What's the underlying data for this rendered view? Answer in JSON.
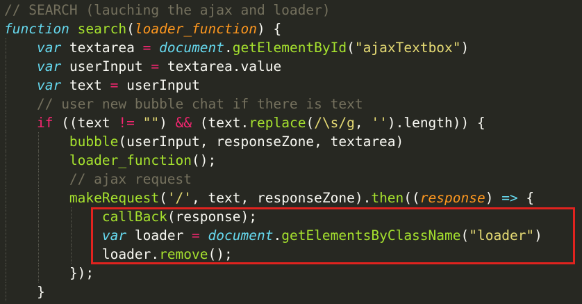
{
  "colors": {
    "background": "#272822",
    "comment": "#75715e",
    "keyword": "#66d9ef",
    "function": "#a6e22e",
    "parameter": "#fd971f",
    "operator": "#f92672",
    "string": "#e6db74",
    "plain": "#f8f8f2",
    "highlight_box": "#e0231f"
  },
  "code_lines": [
    {
      "indent": 0,
      "tokens": [
        {
          "t": "// SEARCH (lauching the ajax and loader)",
          "c": "comment"
        }
      ]
    },
    {
      "indent": 0,
      "tokens": [
        {
          "t": "function",
          "c": "kw"
        },
        {
          "t": " ",
          "c": "plain"
        },
        {
          "t": "search",
          "c": "fn"
        },
        {
          "t": "(",
          "c": "plain"
        },
        {
          "t": "loader_function",
          "c": "param"
        },
        {
          "t": ") {",
          "c": "plain"
        }
      ]
    },
    {
      "indent": 1,
      "tokens": [
        {
          "t": "var",
          "c": "kw"
        },
        {
          "t": " textarea ",
          "c": "plain"
        },
        {
          "t": "=",
          "c": "op"
        },
        {
          "t": " ",
          "c": "plain"
        },
        {
          "t": "document",
          "c": "builtin"
        },
        {
          "t": ".",
          "c": "plain"
        },
        {
          "t": "getElementById",
          "c": "fn"
        },
        {
          "t": "(",
          "c": "plain"
        },
        {
          "t": "\"ajaxTextbox\"",
          "c": "str"
        },
        {
          "t": ")",
          "c": "plain"
        }
      ]
    },
    {
      "indent": 1,
      "tokens": [
        {
          "t": "var",
          "c": "kw"
        },
        {
          "t": " userInput ",
          "c": "plain"
        },
        {
          "t": "=",
          "c": "op"
        },
        {
          "t": " textarea.value",
          "c": "plain"
        }
      ]
    },
    {
      "indent": 1,
      "tokens": [
        {
          "t": "var",
          "c": "kw"
        },
        {
          "t": " text ",
          "c": "plain"
        },
        {
          "t": "=",
          "c": "op"
        },
        {
          "t": " userInput",
          "c": "plain"
        }
      ]
    },
    {
      "indent": 1,
      "tokens": [
        {
          "t": "// user new bubble chat if there is text",
          "c": "comment"
        }
      ]
    },
    {
      "indent": 1,
      "tokens": [
        {
          "t": "if",
          "c": "op"
        },
        {
          "t": " ((text ",
          "c": "plain"
        },
        {
          "t": "!=",
          "c": "op"
        },
        {
          "t": " ",
          "c": "plain"
        },
        {
          "t": "\"\"",
          "c": "str"
        },
        {
          "t": ") ",
          "c": "plain"
        },
        {
          "t": "&&",
          "c": "op"
        },
        {
          "t": " (text.",
          "c": "plain"
        },
        {
          "t": "replace",
          "c": "fn"
        },
        {
          "t": "(",
          "c": "plain"
        },
        {
          "t": "/\\s/g",
          "c": "str"
        },
        {
          "t": ", ",
          "c": "plain"
        },
        {
          "t": "''",
          "c": "str"
        },
        {
          "t": ").length)) {",
          "c": "plain"
        }
      ]
    },
    {
      "indent": 2,
      "tokens": [
        {
          "t": "bubble",
          "c": "fn"
        },
        {
          "t": "(userInput, responseZone, textarea)",
          "c": "plain"
        }
      ]
    },
    {
      "indent": 2,
      "tokens": [
        {
          "t": "loader_function",
          "c": "fn"
        },
        {
          "t": "();",
          "c": "plain"
        }
      ]
    },
    {
      "indent": 2,
      "tokens": [
        {
          "t": "// ajax request",
          "c": "comment"
        }
      ]
    },
    {
      "indent": 2,
      "tokens": [
        {
          "t": "makeRequest",
          "c": "fn"
        },
        {
          "t": "(",
          "c": "plain"
        },
        {
          "t": "'/'",
          "c": "str"
        },
        {
          "t": ", text, responseZone).",
          "c": "plain"
        },
        {
          "t": "then",
          "c": "fn"
        },
        {
          "t": "((",
          "c": "plain"
        },
        {
          "t": "response",
          "c": "param"
        },
        {
          "t": ") ",
          "c": "plain"
        },
        {
          "t": "=>",
          "c": "kw"
        },
        {
          "t": " {",
          "c": "plain"
        }
      ]
    },
    {
      "indent": 3,
      "tokens": [
        {
          "t": "callBack",
          "c": "fn"
        },
        {
          "t": "(response);",
          "c": "plain"
        }
      ]
    },
    {
      "indent": 3,
      "tokens": [
        {
          "t": "var",
          "c": "kw"
        },
        {
          "t": " loader ",
          "c": "plain"
        },
        {
          "t": "=",
          "c": "op"
        },
        {
          "t": " ",
          "c": "plain"
        },
        {
          "t": "document",
          "c": "builtin"
        },
        {
          "t": ".",
          "c": "plain"
        },
        {
          "t": "getElementsByClassName",
          "c": "fn"
        },
        {
          "t": "(",
          "c": "plain"
        },
        {
          "t": "\"loader\"",
          "c": "str"
        },
        {
          "t": ")",
          "c": "plain"
        }
      ]
    },
    {
      "indent": 3,
      "tokens": [
        {
          "t": "loader.",
          "c": "plain"
        },
        {
          "t": "remove",
          "c": "fn"
        },
        {
          "t": "();",
          "c": "plain"
        }
      ]
    },
    {
      "indent": 2,
      "tokens": [
        {
          "t": "});",
          "c": "plain"
        }
      ]
    },
    {
      "indent": 1,
      "tokens": [
        {
          "t": "}",
          "c": "plain"
        }
      ]
    }
  ]
}
